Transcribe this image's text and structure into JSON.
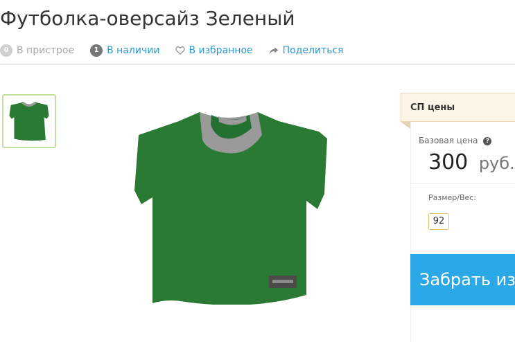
{
  "product": {
    "title": "Футболка-оверсайз Зеленый"
  },
  "meta": {
    "in_building_count": "0",
    "in_building_label": "В пристрое",
    "in_stock_count": "1",
    "in_stock_label": "В наличии",
    "favorites_label": "В избранное",
    "share_label": "Поделиться"
  },
  "panel": {
    "header": "СП цены",
    "base_price_label": "Базовая цена",
    "price": "300",
    "currency": "руб.",
    "size_label": "Размер/Вес:",
    "size_value": "92",
    "cta_label": "Забрать из пристроя"
  },
  "colors": {
    "shirt_green": "#2a7a34",
    "collar_grey": "#9a9a9a",
    "link_blue": "#2a9ad1",
    "cta_blue": "#2aa9e6"
  },
  "icons": {
    "favorite": "heart-outline-icon",
    "share": "share-arrow-icon",
    "help": "question-circle-icon"
  }
}
